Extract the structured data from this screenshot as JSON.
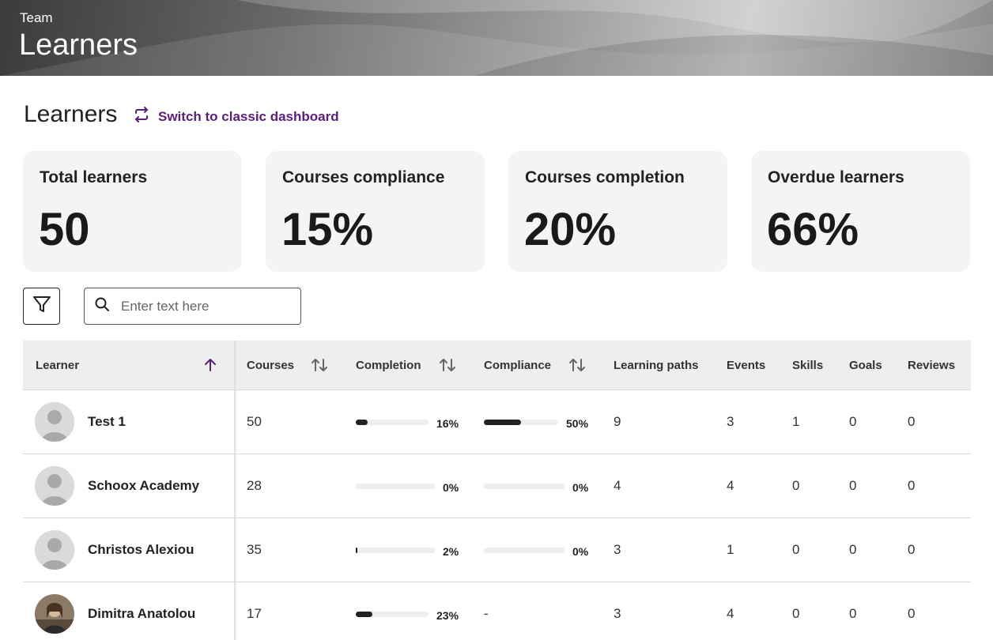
{
  "banner": {
    "eyebrow": "Team",
    "title": "Learners"
  },
  "page": {
    "title": "Learners",
    "switch_label": "Switch to classic dashboard"
  },
  "stats": [
    {
      "label": "Total learners",
      "value": "50"
    },
    {
      "label": "Courses compliance",
      "value": "15%"
    },
    {
      "label": "Courses completion",
      "value": "20%"
    },
    {
      "label": "Overdue learners",
      "value": "66%"
    }
  ],
  "search": {
    "placeholder": "Enter text here",
    "value": ""
  },
  "table": {
    "columns": {
      "learner": "Learner",
      "courses": "Courses",
      "completion": "Completion",
      "compliance": "Compliance",
      "learning_paths": "Learning paths",
      "events": "Events",
      "skills": "Skills",
      "goals": "Goals",
      "reviews": "Reviews"
    },
    "rows": [
      {
        "name": "Test 1",
        "courses": "50",
        "completion": "16%",
        "completion_value": 0.16,
        "compliance": "50%",
        "compliance_value": 0.5,
        "learning_paths": "9",
        "events": "3",
        "skills": "1",
        "goals": "0",
        "reviews": "0",
        "avatar": "placeholder-avatar"
      },
      {
        "name": "Schoox Academy",
        "courses": "28",
        "completion": "0%",
        "completion_value": 0,
        "compliance": "0%",
        "compliance_value": 0,
        "learning_paths": "4",
        "events": "4",
        "skills": "0",
        "goals": "0",
        "reviews": "0",
        "avatar": "placeholder-avatar"
      },
      {
        "name": "Christos Alexiou",
        "courses": "35",
        "completion": "2%",
        "completion_value": 0.02,
        "compliance": "0%",
        "compliance_value": 0,
        "learning_paths": "3",
        "events": "1",
        "skills": "0",
        "goals": "0",
        "reviews": "0",
        "avatar": "placeholder-avatar"
      },
      {
        "name": "Dimitra Anatolou",
        "courses": "17",
        "completion": "23%",
        "completion_value": 0.23,
        "compliance": "-",
        "compliance_value": null,
        "learning_paths": "3",
        "events": "4",
        "skills": "0",
        "goals": "0",
        "reviews": "0",
        "avatar": "photo-avatar"
      }
    ]
  },
  "colors": {
    "accent": "#5b1e7a",
    "bar_fill": "#222222",
    "bar_track": "#eeeeee",
    "card_bg": "#f4f4f4",
    "header_bg": "#eeeeee"
  },
  "icons": {
    "switch": "swap-arrows-icon",
    "filter": "filter-funnel-icon",
    "search": "search-icon",
    "sort_asc": "arrow-up-icon",
    "sort_both": "sort-arrows-icon"
  }
}
